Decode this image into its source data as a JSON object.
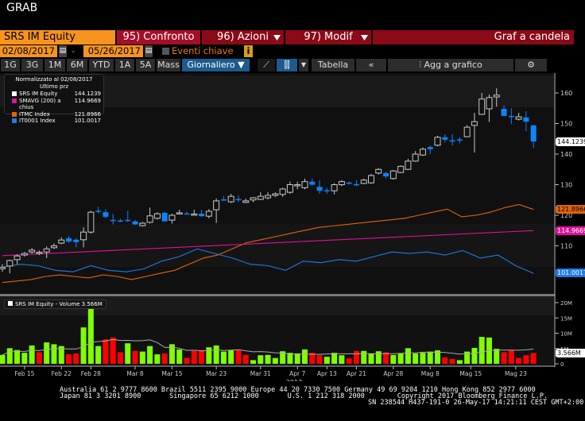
{
  "window_title": "GRAB",
  "toolbar": {
    "security": "SRS IM Equity",
    "compare": "95) Confronto",
    "actions": "96) Azioni",
    "edit": "97) Modif",
    "chart_type": "Graf a candela"
  },
  "dates": {
    "start": "02/08/2017",
    "sep": "-",
    "end": "05/26/2017",
    "key_events": "Eventi chiave",
    "info_icon": "i"
  },
  "periods": [
    "1G",
    "3G",
    "1M",
    "6M",
    "YTD",
    "1A",
    "5A",
    "Mass"
  ],
  "frequency": "Giornaliero ▼",
  "buttons": {
    "table": "Tabella",
    "collapse": "«",
    "add_to_chart": "Agg a grafico"
  },
  "colors": {
    "up": "#ffffff",
    "down": "#0a84ff",
    "vol_up": "#7fff00",
    "vol_down": "#ff0000",
    "itmc": "#e0640a",
    "smavg": "#e0109c",
    "it0001": "#1e7ae6",
    "orange": "#f7941d",
    "red": "#8a0a18"
  },
  "legend": {
    "title": "Normalizzato al 02/08/2017",
    "subtitle": "Ultimo prz",
    "items": [
      {
        "label": "SRS IM Equity",
        "value": "144.1239",
        "color": "#ffffff"
      },
      {
        "label": "SMAVG (200) a chius",
        "value": "114.9669",
        "color": "#e0109c"
      },
      {
        "label": "ITMC Index",
        "value": "121.8966",
        "color": "#e0640a"
      },
      {
        "label": "IT0001 Index",
        "value": "101.0017",
        "color": "#1e7ae6"
      }
    ]
  },
  "volume_legend": "SRS IM Equity - Volume 3.566M",
  "chart_data": {
    "type": "candlestick",
    "price_axis": {
      "ticks": [
        110,
        120,
        130,
        140,
        150,
        160
      ],
      "range": [
        97,
        165
      ]
    },
    "volume_axis": {
      "ticks": [
        "0",
        "5M",
        "10M",
        "15M",
        "20M"
      ],
      "values": [
        0,
        5,
        10,
        15,
        20
      ]
    },
    "x_ticks": [
      {
        "label": "Feb 15",
        "i": 3
      },
      {
        "label": "Feb 22",
        "i": 8
      },
      {
        "label": "Feb 28",
        "i": 12
      },
      {
        "label": "Mar 8",
        "i": 18
      },
      {
        "label": "Mar 15",
        "i": 23
      },
      {
        "label": "Mar 23",
        "i": 29
      },
      {
        "label": "Mar 31",
        "i": 35
      },
      {
        "label": "Apr 7",
        "i": 40
      },
      {
        "label": "Apr 13",
        "i": 44
      },
      {
        "label": "Apr 21",
        "i": 48
      },
      {
        "label": "Apr 28",
        "i": 53
      },
      {
        "label": "Mag 8",
        "i": 58
      },
      {
        "label": "Mag 15",
        "i": 63.5
      },
      {
        "label": "Mag 23",
        "i": 69.6
      }
    ],
    "x_year": "2017",
    "ohlc": [
      [
        102.5,
        104,
        101.5,
        103
      ],
      [
        103.4,
        105.5,
        101,
        105.2
      ],
      [
        105.5,
        107.2,
        104,
        106.7
      ],
      [
        107,
        108,
        106.5,
        107.5
      ],
      [
        108,
        109.3,
        107.5,
        108.6
      ],
      [
        107.8,
        108.5,
        107,
        107.9
      ],
      [
        108,
        109.8,
        106,
        109
      ],
      [
        109.4,
        110.8,
        109,
        110
      ],
      [
        110.9,
        112.8,
        110.5,
        111.9
      ],
      [
        112.5,
        113.2,
        111,
        111.4
      ],
      [
        112,
        112.5,
        109.5,
        111.2
      ],
      [
        112,
        116,
        109.5,
        114.5
      ],
      [
        114.5,
        121.5,
        114,
        121
      ],
      [
        121.5,
        122.8,
        120.5,
        121.4
      ],
      [
        121,
        122,
        119,
        119.5
      ],
      [
        118.5,
        120.5,
        117,
        118.4
      ],
      [
        118.3,
        118.8,
        117.8,
        118.2
      ],
      [
        118.5,
        121.5,
        117.8,
        118.3
      ],
      [
        118,
        118.5,
        116.8,
        117
      ],
      [
        116.6,
        117.8,
        116.3,
        117.4
      ],
      [
        117.7,
        122.5,
        117.3,
        119.8
      ],
      [
        119,
        121,
        118.6,
        120.5
      ],
      [
        120.8,
        121,
        118,
        118
      ],
      [
        118.4,
        120.5,
        117.3,
        120
      ],
      [
        120.8,
        121.8,
        120.5,
        120.8
      ],
      [
        120.6,
        121.2,
        120.4,
        120.5
      ],
      [
        120.4,
        121.8,
        120.3,
        120.4
      ],
      [
        120.5,
        121.8,
        119.5,
        119.7
      ],
      [
        119.7,
        122,
        119,
        121.3
      ],
      [
        121.8,
        125.5,
        117.5,
        124.7
      ],
      [
        125.2,
        126.3,
        124.7,
        125.1
      ],
      [
        124.4,
        127,
        124,
        126.2
      ],
      [
        125.3,
        126.5,
        124.3,
        125.2
      ],
      [
        124.2,
        125.5,
        124,
        124.7
      ],
      [
        125,
        126,
        124.3,
        125.7
      ],
      [
        125.2,
        127.5,
        125,
        126.2
      ],
      [
        125.7,
        127.5,
        125.2,
        126.5
      ],
      [
        126.5,
        127.5,
        126,
        127
      ],
      [
        126.8,
        129,
        126,
        128.6
      ],
      [
        127.5,
        131,
        127,
        130
      ],
      [
        130,
        131,
        128.5,
        130
      ],
      [
        129,
        132,
        128.5,
        131
      ],
      [
        131,
        132,
        129.8,
        130
      ],
      [
        129.3,
        131.5,
        127,
        128
      ],
      [
        128.2,
        129,
        127,
        128
      ],
      [
        128,
        130.5,
        126.8,
        130
      ],
      [
        130,
        131.5,
        129.5,
        131
      ],
      [
        130.7,
        131,
        130,
        130.5
      ],
      [
        130.2,
        131.5,
        129.5,
        130
      ],
      [
        130.4,
        132,
        130.2,
        131.5
      ],
      [
        130.6,
        133.5,
        130.3,
        133
      ],
      [
        133.8,
        135.4,
        133.3,
        135
      ],
      [
        133.8,
        134.2,
        132,
        132.7
      ],
      [
        132,
        134.8,
        131.7,
        134.5
      ],
      [
        134,
        136.3,
        133.8,
        136
      ],
      [
        135,
        138.5,
        134.8,
        137.7
      ],
      [
        137.7,
        141,
        137.5,
        140
      ],
      [
        139.7,
        142.2,
        139.4,
        141.6
      ],
      [
        142.3,
        142.8,
        140,
        141.6
      ],
      [
        142.9,
        146,
        142.5,
        145.5
      ],
      [
        145.5,
        146.5,
        143.8,
        144.7
      ],
      [
        144.5,
        146.5,
        142.8,
        144.3
      ],
      [
        144.8,
        145.5,
        143.5,
        144.4
      ],
      [
        145.7,
        149.5,
        145.5,
        148.8
      ],
      [
        149.4,
        153.5,
        140.5,
        150.6
      ],
      [
        153,
        160,
        152.8,
        158
      ],
      [
        154.8,
        159.5,
        150.5,
        158.5
      ],
      [
        158.7,
        161.5,
        155.5,
        159.3
      ],
      [
        154.8,
        155.9,
        152.4,
        152.5
      ],
      [
        152.5,
        155,
        149.8,
        152.3
      ],
      [
        151.4,
        153.5,
        151,
        152.2
      ],
      [
        152,
        154,
        147.5,
        150.6
      ],
      [
        149.4,
        149.5,
        142,
        144.1239
      ]
    ],
    "volume_millions": [
      2.9,
      5.1,
      4.5,
      3.6,
      6,
      3.8,
      7,
      6.4,
      5.8,
      3.1,
      3.4,
      11.9,
      19.5,
      5.8,
      8,
      8.6,
      3.8,
      6.7,
      4.2,
      4,
      5.8,
      3.1,
      3.4,
      6.4,
      4.7,
      1.9,
      4.2,
      4.5,
      5.4,
      6,
      4,
      4.5,
      4.5,
      2.9,
      1.2,
      2.8,
      2.9,
      1.9,
      4.1,
      3.6,
      3.4,
      4.7,
      3.6,
      2.8,
      2.3,
      3.6,
      2.8,
      1.8,
      4.2,
      4.2,
      3.3,
      4.1,
      3.8,
      2.9,
      3.4,
      5.1,
      3.4,
      3.6,
      4,
      4.4,
      2.1,
      1.6,
      1.2,
      4,
      5.2,
      8.8,
      8.6,
      4.9,
      3.8,
      4.5,
      1.9,
      2.8,
      3.566
    ],
    "series": [
      {
        "name": "ITMC Index",
        "values": [
          98,
          98.5,
          99,
          100,
          100.5,
          100,
          99.5,
          100.5,
          100,
          99,
          100,
          101,
          102,
          104,
          106,
          107,
          109,
          111,
          112,
          113,
          114,
          115,
          116,
          116.5,
          117,
          117.5,
          118,
          118.5,
          119,
          120,
          121,
          122,
          119.5,
          120,
          121,
          122.5,
          123.5,
          121.9
        ]
      },
      {
        "name": "SMAVG (200) a chius",
        "values": [
          106.8,
          115
        ]
      },
      {
        "name": "IT0001 Index",
        "values": [
          103,
          104,
          103.5,
          102,
          101.5,
          103.5,
          102,
          101.5,
          102.5,
          105,
          106.5,
          109,
          107.5,
          106,
          104,
          103.5,
          102,
          105,
          104.5,
          105.5,
          105,
          106.5,
          108,
          107.5,
          108,
          107,
          108.5,
          106,
          107,
          103.5,
          101.0017
        ]
      }
    ]
  }
}
